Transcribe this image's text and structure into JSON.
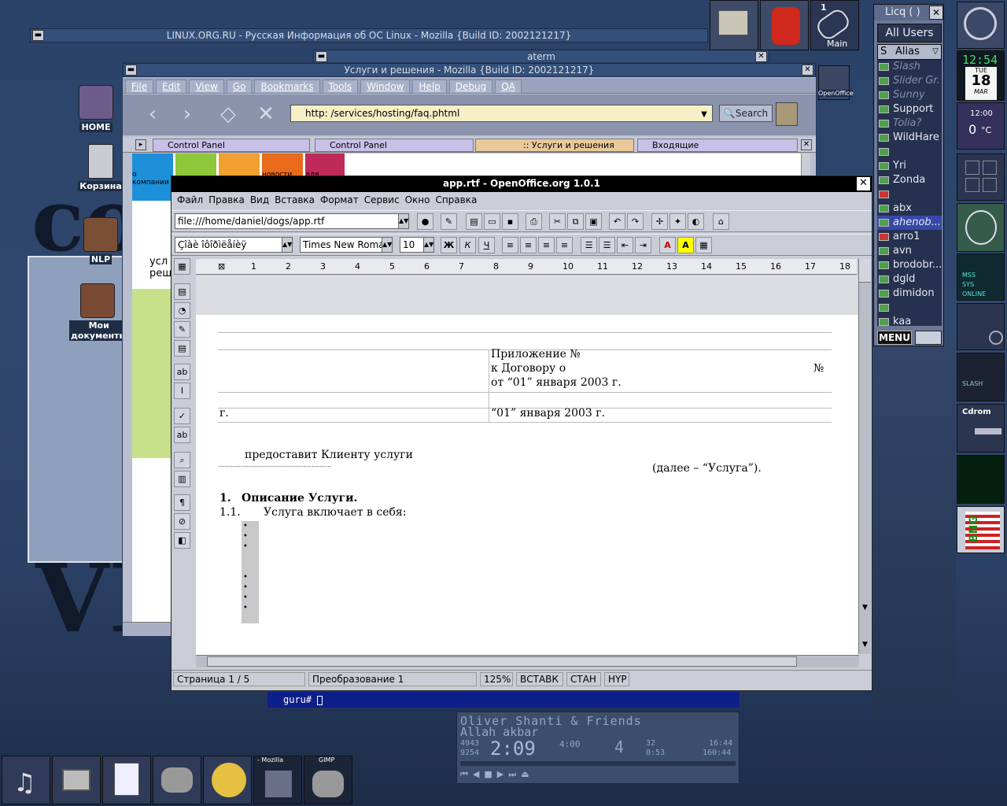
{
  "desktop": {
    "icons": [
      {
        "label": "HOME"
      },
      {
        "label": "Корзина"
      },
      {
        "label": "NLP"
      },
      {
        "label": "Мои документы"
      }
    ],
    "letters": [
      "co",
      "VI"
    ]
  },
  "lor_window": {
    "title": "LINUX.ORG.RU - Русская Информация об ОС Linux - Mozilla {Build ID: 2002121217}"
  },
  "aterm_window": {
    "title": "aterm",
    "prompt": "guru# "
  },
  "mozilla": {
    "title": "Услуги и решения - Mozilla {Build ID: 2002121217}",
    "menu": [
      "File",
      "Edit",
      "View",
      "Go",
      "Bookmarks",
      "Tools",
      "Window",
      "Help",
      "Debug",
      "QA"
    ],
    "url": "http:                /services/hosting/faq.phtml",
    "search_label": "Search",
    "tabs": [
      "Control Panel",
      "Control Panel",
      ":: Услуги и решения",
      "Входящие"
    ],
    "nav_tiles": [
      "о компании",
      "",
      "",
      "новости",
      "для"
    ],
    "side_text": "усл реш"
  },
  "openoffice": {
    "title": "app.rtf - OpenOffice.org 1.0.1",
    "menu": [
      "Файл",
      "Правка",
      "Вид",
      "Вставка",
      "Формат",
      "Сервис",
      "Окно",
      "Справка"
    ],
    "url": "file:///home/daniel/dogs/app.rtf",
    "style": "Çîàè îôîðìëåíèÿ",
    "font": "Times New Roma",
    "size": "10",
    "bold": "Ж",
    "italic": "К",
    "underline": "Ч",
    "ruler": [
      "1",
      "2",
      "3",
      "4",
      "5",
      "6",
      "7",
      "8",
      "9",
      "10",
      "11",
      "12",
      "13",
      "14",
      "15",
      "16",
      "17",
      "18"
    ],
    "doc": {
      "appendix": "Приложение №",
      "contract": "к Договору о",
      "contract_no": "№",
      "date1": "от “01” января  2003 г.",
      "city": "г.",
      "date2": "“01” января  2003 г.",
      "provides": "предоставит Клиенту услуги",
      "hereafter": "(далее – “Услуга”).",
      "section_no": "1.",
      "section_title": "Описание Услуги.",
      "sub_no": "1.1.",
      "sub_text": "Услуга включает в себя:"
    },
    "status": {
      "page": "Страница  1 / 5",
      "mode": "Преобразование 1",
      "zoom": "125%",
      "insert": "ВСТАВК",
      "std": "СТАН",
      "hyp": "HYP"
    }
  },
  "licq": {
    "title": "Licq ( )",
    "group": "All Users",
    "header_s": "S",
    "header_alias": "Alias",
    "contacts": [
      {
        "name": "Slash",
        "state": "off"
      },
      {
        "name": "Slider Gr.",
        "state": "off"
      },
      {
        "name": "Sunny",
        "state": "off"
      },
      {
        "name": "Support",
        "state": "on"
      },
      {
        "name": "Tolia?",
        "state": "off"
      },
      {
        "name": "WildHare",
        "state": "on"
      },
      {
        "name": "",
        "state": "on"
      },
      {
        "name": "Yri",
        "state": "on"
      },
      {
        "name": "Zonda",
        "state": "on"
      },
      {
        "name": "",
        "state": "on"
      },
      {
        "name": "abx",
        "state": "on"
      },
      {
        "name": "ahenob...",
        "state": "sel"
      },
      {
        "name": "arro1",
        "state": "on"
      },
      {
        "name": "avn",
        "state": "on"
      },
      {
        "name": "brodobr...",
        "state": "on"
      },
      {
        "name": "dgld",
        "state": "on"
      },
      {
        "name": "dimidon",
        "state": "on"
      },
      {
        "name": "",
        "state": "on"
      },
      {
        "name": "kaa",
        "state": "on"
      }
    ],
    "menu_label": "MENU"
  },
  "dock": {
    "clock": "12:54",
    "day": "TUE",
    "date": "18",
    "month": "MAR",
    "weather_time": "12:00",
    "weather_temp": "0",
    "weather_unit": "°C",
    "cdrom": "Cdrom",
    "slash": "SLASH",
    "main_label": "Main",
    "openoffice_label": "OpenOffice",
    "desk_num": "1",
    "online": "ONLINE",
    "mss": "MSS",
    "sys": "SYS",
    "bng": "BNG"
  },
  "taskbar": {
    "mozilla_label": "- Mozilla",
    "gimp_label": "GIMP"
  },
  "xmms": {
    "song": "Oliver Shanti & Friends",
    "song2": "Allah akbar",
    "time": "2:09",
    "count": "4:00",
    "bitrate": "9254",
    "num1": "4943",
    "track": "4",
    "a": "32",
    "b": "0:53",
    "c": "16:44",
    "d": "160:44"
  }
}
